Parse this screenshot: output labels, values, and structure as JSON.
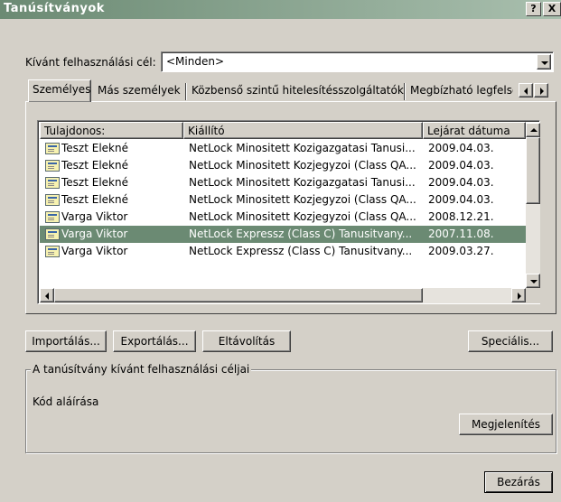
{
  "window": {
    "title": "Tanúsítványok",
    "help_label": "?",
    "close_label": "X"
  },
  "purpose": {
    "label": "Kívánt felhasználási cél:",
    "value": "<Minden>"
  },
  "tabs": [
    {
      "label": "Személyes",
      "active": true
    },
    {
      "label": "Más személyek"
    },
    {
      "label": "Közbenső szintű hitelesítésszolgáltatók"
    },
    {
      "label": "Megbízható legfelső"
    }
  ],
  "table": {
    "columns": [
      "Tulajdonos:",
      "Kiállító",
      "Lejárat dátuma"
    ],
    "rows": [
      {
        "owner": "Teszt Elekné",
        "issuer": "NetLock Minositett Kozigazgatasi Tanusi...",
        "expiry": "2009.04.03.",
        "selected": false
      },
      {
        "owner": "Teszt Elekné",
        "issuer": "NetLock Minositett Kozjegyzoi (Class QA...",
        "expiry": "2009.04.03.",
        "selected": false
      },
      {
        "owner": "Teszt Elekné",
        "issuer": "NetLock Minositett Kozigazgatasi Tanusi...",
        "expiry": "2009.04.03.",
        "selected": false
      },
      {
        "owner": "Teszt Elekné",
        "issuer": "NetLock Minositett Kozjegyzoi (Class QA...",
        "expiry": "2009.04.03.",
        "selected": false
      },
      {
        "owner": "Varga Viktor",
        "issuer": "NetLock Minositett Kozjegyzoi (Class QA...",
        "expiry": "2008.12.21.",
        "selected": false
      },
      {
        "owner": "Varga Viktor",
        "issuer": "NetLock Expressz (Class C) Tanusitvany...",
        "expiry": "2007.11.08.",
        "selected": true
      },
      {
        "owner": "Varga Viktor",
        "issuer": "NetLock Expressz (Class C) Tanusitvany...",
        "expiry": "2009.03.27.",
        "selected": false
      }
    ]
  },
  "buttons": {
    "import": "Importálás...",
    "export": "Exportálás...",
    "remove": "Eltávolítás",
    "advanced": "Speciális...",
    "view": "Megjelenítés",
    "close": "Bezárás"
  },
  "purposes_group": {
    "title": "A tanúsítvány kívánt felhasználási céljai",
    "value": "Kód aláírása"
  },
  "colors": {
    "selection": "#6b8a73",
    "face": "#d4d0c8"
  }
}
